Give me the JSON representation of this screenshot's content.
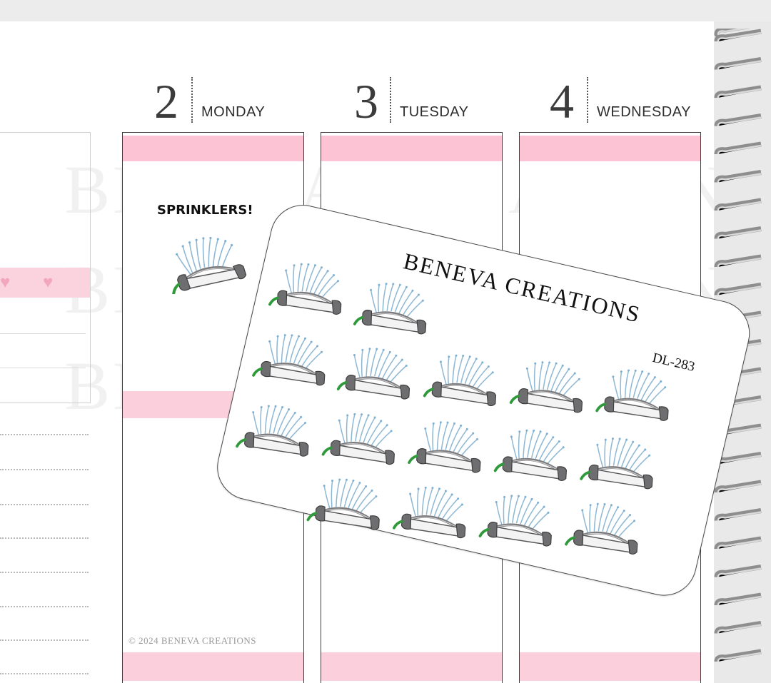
{
  "planner": {
    "days": [
      {
        "number": "2",
        "name": "MONDAY"
      },
      {
        "number": "3",
        "name": "TUESDAY"
      },
      {
        "number": "4",
        "name": "WEDNESDAY"
      }
    ],
    "sample_label": "SPRINKLERS!",
    "copyright": "© 2024  BENEVA CREATIONS",
    "watermark": "BENEVA CREATIONS"
  },
  "sheet": {
    "brand": "BENEVA CREATIONS",
    "code": "DL-283",
    "sticker_count": 16,
    "sticker_icon": "sprinkler-icon"
  },
  "colors": {
    "pink_band": "#fbc3d3",
    "page": "#ffffff",
    "hose_green": "#2f9a3a",
    "sprinkler_gray": "#6e6e70",
    "water_blue": "#9ec3dc"
  }
}
